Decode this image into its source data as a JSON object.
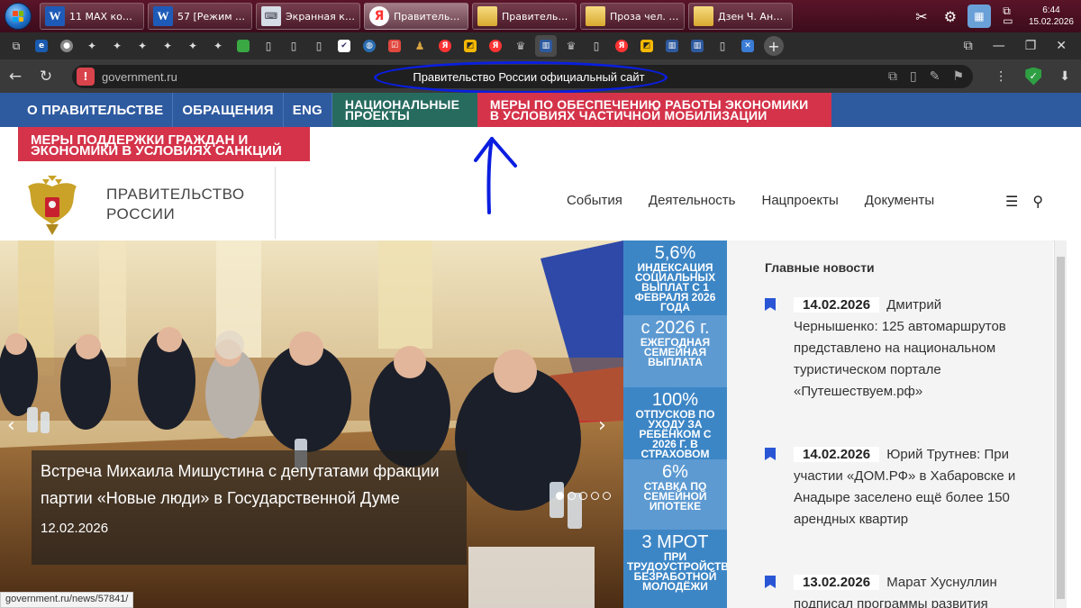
{
  "taskbar": {
    "tasks": [
      {
        "icon": "word-icon",
        "glyph": "W",
        "label": "11 МАХ комм..."
      },
      {
        "icon": "word-icon",
        "glyph": "W",
        "label": "57 [Режим ог..."
      },
      {
        "icon": "keyboard-icon",
        "glyph": "⌨",
        "label": "Экранная кла..."
      },
      {
        "icon": "yandex-browser-icon",
        "glyph": "Я",
        "label": "Правительств..."
      },
      {
        "icon": "folder-icon",
        "glyph": "",
        "label": "Правительств..."
      },
      {
        "icon": "folder-icon",
        "glyph": "",
        "label": "Проза чел. А..."
      },
      {
        "icon": "folder-icon",
        "glyph": "",
        "label": "Дзен Ч. Антон"
      }
    ],
    "clock": {
      "time": "6:44",
      "date": "15.02.2026"
    }
  },
  "browser": {
    "domain": "government.ru",
    "page_title": "Правительство России официальный сайт",
    "status_url": "government.ru/news/57841/"
  },
  "site": {
    "menu": [
      "О ПРАВИТЕЛЬСТВЕ",
      "ОБРАЩЕНИЯ",
      "ENG"
    ],
    "projects_label": "НАЦИОНАЛЬНЫЕ ПРОЕКТЫ",
    "mobilization_label": "МЕРЫ ПО ОБЕСПЕЧЕНИЮ РАБОТЫ ЭКОНОМИКИ В УСЛОВИЯХ ЧАСТИЧНОЙ МОБИЛИЗАЦИИ",
    "sanctions_label": "МЕРЫ ПОДДЕРЖКИ ГРАЖДАН И ЭКОНОМИКИ В УСЛОВИЯХ САНКЦИЙ",
    "logo_line1": "ПРАВИТЕЛЬСТВО",
    "logo_line2": "РОССИИ",
    "nav": [
      "События",
      "Деятельность",
      "Нацпроекты",
      "Документы"
    ]
  },
  "hero": {
    "title": "Встреча Михаила Мишустина с депутатами фракции партии «Новые люди» в Государственной Думе",
    "date": "12.02.2026",
    "slides": 5,
    "active_slide": 1
  },
  "stats": [
    {
      "big": "5,6%",
      "small": "ИНДЕКСАЦИЯ СОЦИАЛЬНЫХ ВЫПЛАТ С 1 ФЕВРАЛЯ 2026 ГОДА"
    },
    {
      "big": "с 2026 г.",
      "small": "ЕЖЕГОДНАЯ СЕМЕЙНАЯ ВЫПЛАТА"
    },
    {
      "big": "100%",
      "small": "ОТПУСКОВ ПО УХОДУ ЗА РЕБЁНКОМ С 2026 Г. В СТРАХОВОМ СТАЖЕ"
    },
    {
      "big": "6%",
      "small": "СТАВКА ПО СЕМЕЙНОЙ ИПОТЕКЕ"
    },
    {
      "big": "3 МРОТ",
      "small": "ПРИ ТРУДОУСТРОЙСТВЕ БЕЗРАБОТНОЙ МОЛОДЁЖИ"
    }
  ],
  "news": {
    "heading": "Главные новости",
    "items": [
      {
        "date": "14.02.2026",
        "text": "Дмитрий Чернышенко: 125 автомаршрутов представлено на национальном туристическом портале «Путешествуем.рф»"
      },
      {
        "date": "14.02.2026",
        "text": "Юрий Трутнев: При участии «ДОМ.РФ» в Хабаровске и Анадыре заселено ещё более 150 арендных квартир"
      },
      {
        "date": "13.02.2026",
        "text": "Марат Хуснуллин подписал программы развития"
      }
    ]
  },
  "colors": {
    "site_blue": "#2e5a9f",
    "projects_green": "#276b5f",
    "alert_red": "#d4334a",
    "stat_blue": "#3d86c6",
    "annotation_blue": "#0a1ee0"
  }
}
